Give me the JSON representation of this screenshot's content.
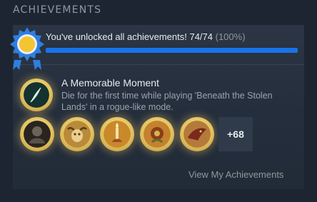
{
  "section_title": "ACHIEVEMENTS",
  "summary": {
    "text": "You've unlocked all achievements! 74/74",
    "percent_text": "(100%)",
    "progress_fraction": 1.0,
    "progress_color": "#1a73e8"
  },
  "featured": {
    "title": "A Memorable Moment",
    "description": "Die for the first time while playing 'Beneath the Stolen Lands' in a rogue-like mode.",
    "icon": "quill-feather-icon"
  },
  "achievement_icons": [
    "armor-helmet-icon",
    "goat-skull-icon",
    "candle-hand-icon",
    "flower-creature-icon",
    "dragon-head-icon"
  ],
  "more_count": "+68",
  "view_link": "View My Achievements",
  "colors": {
    "gold": "#e3c25f",
    "badge_blue": "#2f7fe0",
    "badge_sun": "#f2c531"
  }
}
